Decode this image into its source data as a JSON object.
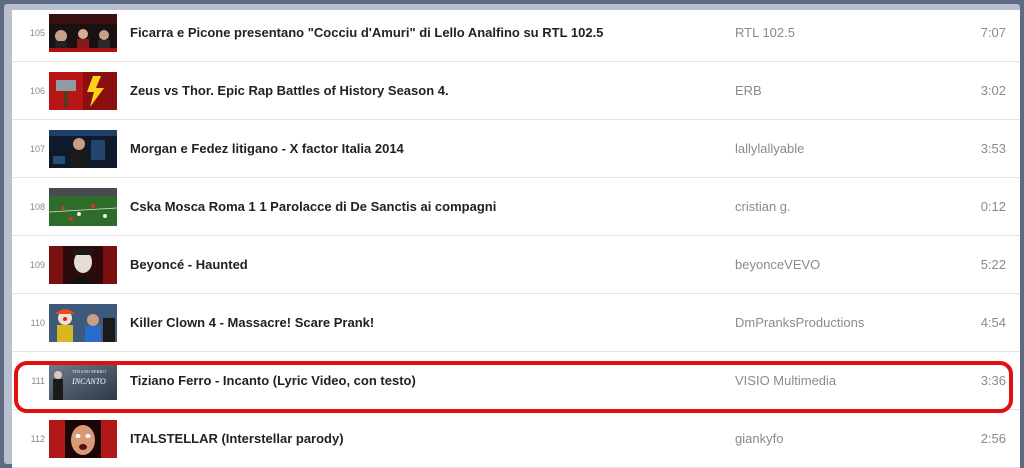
{
  "playlist": {
    "items": [
      {
        "num": "105",
        "title": "Ficarra e Picone presentano \"Cocciu d'Amuri\" di Lello Analfino su RTL 102.5",
        "channel": "RTL 102.5",
        "duration": "7:07",
        "thumb": "tv-studio-thumbnail"
      },
      {
        "num": "106",
        "title": "Zeus vs Thor. Epic Rap Battles of History Season 4.",
        "channel": "ERB",
        "duration": "3:02",
        "thumb": "hammer-lightning-thumbnail"
      },
      {
        "num": "107",
        "title": "Morgan e Fedez litigano - X factor Italia 2014",
        "channel": "lallylallyable",
        "duration": "3:53",
        "thumb": "stage-thumbnail"
      },
      {
        "num": "108",
        "title": "Cska Mosca Roma 1 1 Parolacce di De Sanctis ai compagni",
        "channel": "cristian g.",
        "duration": "0:12",
        "thumb": "football-pitch-thumbnail"
      },
      {
        "num": "109",
        "title": "Beyoncé - Haunted",
        "channel": "beyonceVEVO",
        "duration": "5:22",
        "thumb": "portrait-thumbnail"
      },
      {
        "num": "110",
        "title": "Killer Clown 4 - Massacre! Scare Prank!",
        "channel": "DmPranksProductions",
        "duration": "4:54",
        "thumb": "clown-thumbnail"
      },
      {
        "num": "111",
        "title": "Tiziano Ferro - Incanto (Lyric Video, con testo)",
        "channel": "VISIO Multimedia",
        "duration": "3:36",
        "thumb": "incanto-thumbnail",
        "thumb_text_top": "TIZIANO FERRO",
        "thumb_text_main": "INCANTO"
      },
      {
        "num": "112",
        "title": "ITALSTELLAR (Interstellar parody)",
        "channel": "giankyfo",
        "duration": "2:56",
        "thumb": "face-thumbnail"
      }
    ]
  },
  "highlight": {
    "color": "#e20f0f",
    "target": "111"
  },
  "colors": {
    "title": "#222222",
    "meta": "#8a8a8a",
    "divider": "#e3e3e3"
  }
}
